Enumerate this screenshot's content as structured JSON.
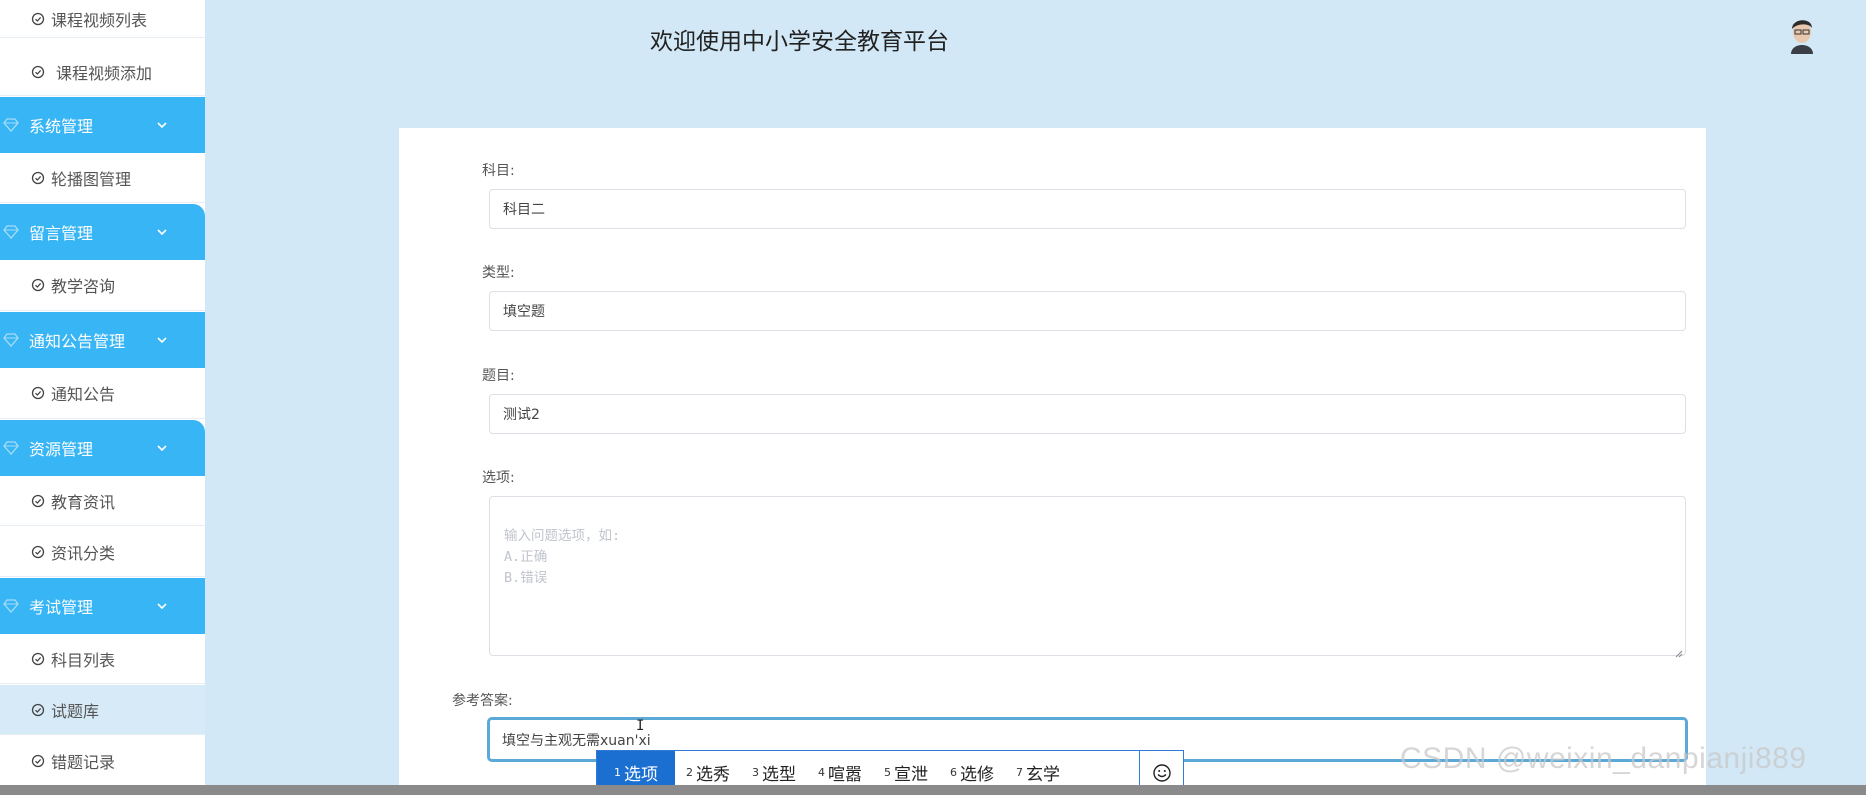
{
  "header": {
    "title": "欢迎使用中小学安全教育平台"
  },
  "sidebar": {
    "items": [
      {
        "type": "item",
        "label": "课程视频列表"
      },
      {
        "type": "item",
        "label": "课程视频添加"
      },
      {
        "type": "group",
        "label": "系统管理"
      },
      {
        "type": "item",
        "label": "轮播图管理"
      },
      {
        "type": "group",
        "label": "留言管理"
      },
      {
        "type": "item",
        "label": "教学咨询"
      },
      {
        "type": "group",
        "label": "通知公告管理"
      },
      {
        "type": "item",
        "label": "通知公告"
      },
      {
        "type": "group",
        "label": "资源管理"
      },
      {
        "type": "item",
        "label": "教育资讯"
      },
      {
        "type": "item",
        "label": "资讯分类"
      },
      {
        "type": "group",
        "label": "考试管理"
      },
      {
        "type": "item",
        "label": "科目列表"
      },
      {
        "type": "item",
        "label": "试题库",
        "active": true
      },
      {
        "type": "item",
        "label": "错题记录"
      }
    ]
  },
  "form": {
    "subject": {
      "label": "科目:",
      "value": "科目二"
    },
    "type": {
      "label": "类型:",
      "value": "填空题"
    },
    "question": {
      "label": "题目:",
      "value": "测试2"
    },
    "options": {
      "label": "选项:",
      "placeholder": "输入问题选项，如:\nA.正确\nB.错误"
    },
    "answer": {
      "label": "参考答案:",
      "value": "填空与主观无需xuan'xi"
    }
  },
  "ime": {
    "candidates": [
      {
        "num": "1",
        "text": "选项"
      },
      {
        "num": "2",
        "text": "选秀"
      },
      {
        "num": "3",
        "text": "选型"
      },
      {
        "num": "4",
        "text": "喧嚣"
      },
      {
        "num": "5",
        "text": "宣泄"
      },
      {
        "num": "6",
        "text": "选修"
      },
      {
        "num": "7",
        "text": "玄学"
      }
    ],
    "selected_index": 0
  },
  "watermark": "CSDN @weixin_danpianji889",
  "colors": {
    "sidebar_group": "#38b5f4",
    "page_bg": "#d2e8f6",
    "ime_selected": "#1a6fd0",
    "active_border": "#5aa9d6"
  }
}
